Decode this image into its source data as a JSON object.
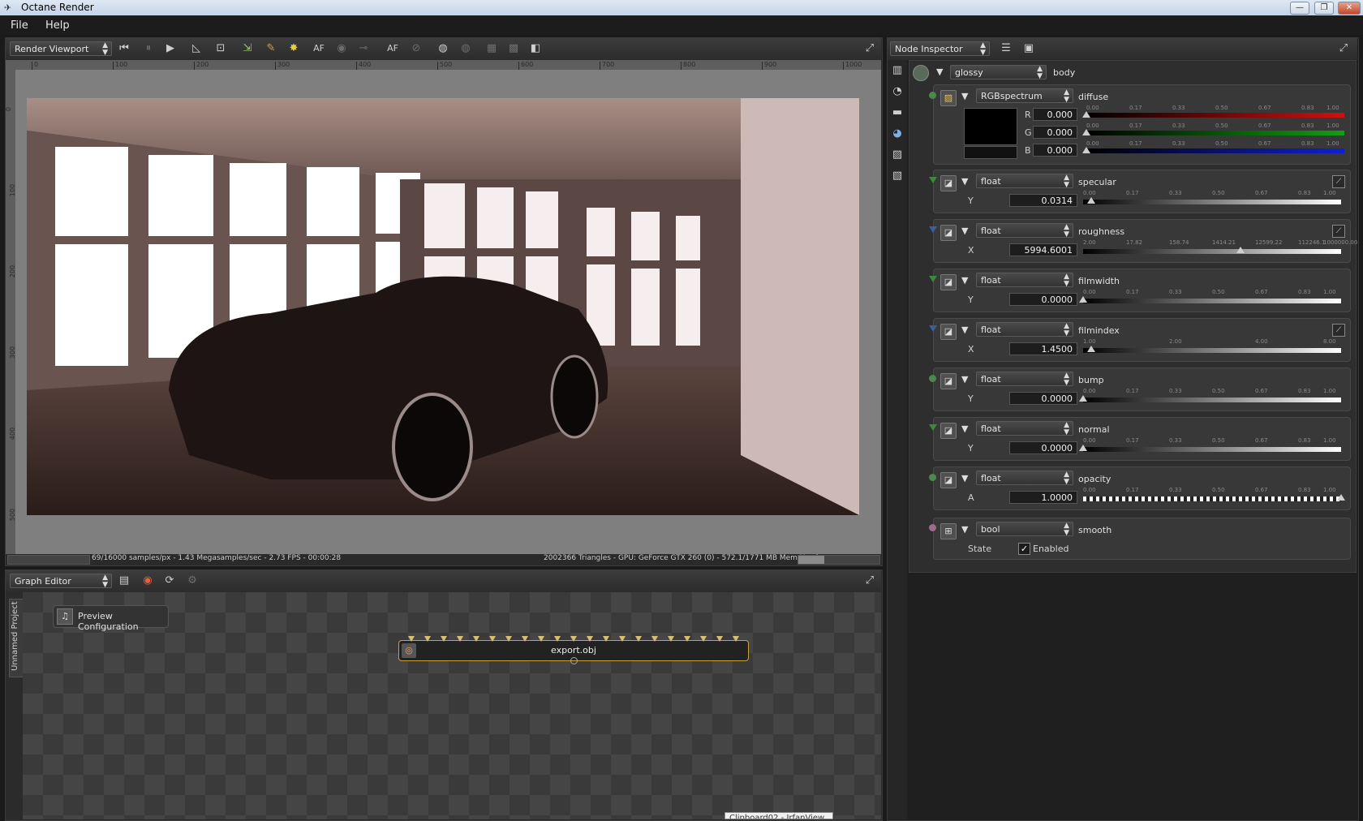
{
  "window": {
    "title": "Octane Render",
    "controls": [
      "minimize",
      "maximize",
      "close"
    ]
  },
  "menu": {
    "items": [
      "File",
      "Help"
    ]
  },
  "viewport": {
    "panel_select": "Render Viewport",
    "toolbar_icons": [
      "rewind-icon",
      "pause-icon",
      "play-icon",
      "measure-icon",
      "region-icon",
      "export-icon",
      "paint-icon",
      "light-icon",
      "af-icon",
      "gray-icon",
      "pick-icon",
      "af-label",
      "lock-icon",
      "world-icon",
      "world2-icon",
      "bg-icon",
      "checker-icon",
      "alpha-icon"
    ],
    "af_label": "AF",
    "ruler_h": [
      "0",
      "100",
      "200",
      "300",
      "400",
      "500",
      "600",
      "700",
      "800",
      "900",
      "1000"
    ],
    "ruler_v": [
      "0",
      "100",
      "200",
      "300",
      "400",
      "500"
    ],
    "status_left": "69/16000 samples/px - 1.43 Megasamples/sec - 2.73 FPS - 00:00:28",
    "status_right": "2002366 Triangles - GPU: GeForce GTX 260 (0) - 572.1/1771 MB Mem Used"
  },
  "graph_editor": {
    "panel_select": "Graph Editor",
    "side_tab": "Unnamed Project",
    "preview_button": "Preview Configuration",
    "node_label": "export.obj",
    "tooltip": "Clipboard02 - IrfanView"
  },
  "inspector": {
    "panel_select": "Node Inspector",
    "root": {
      "type": "glossy",
      "name": "body"
    },
    "diffuse": {
      "type": "RGBspectrum",
      "name": "diffuse",
      "channels": [
        {
          "label": "R",
          "value": "0.000",
          "color": "#d01010"
        },
        {
          "label": "G",
          "value": "0.000",
          "color": "#10a010"
        },
        {
          "label": "B",
          "value": "0.000",
          "color": "#1020d0"
        }
      ],
      "ticks": [
        "0.00",
        "0.17",
        "0.33",
        "0.50",
        "0.67",
        "0.83",
        "1.00"
      ]
    },
    "params": [
      {
        "type": "float",
        "name": "specular",
        "axis": "Y",
        "value": "0.0314",
        "pos": 0.0314,
        "ticks": [
          "0.00",
          "0.17",
          "0.33",
          "0.50",
          "0.67",
          "0.83",
          "1.00"
        ],
        "pin": "#3a8a3a"
      },
      {
        "type": "float",
        "name": "roughness",
        "axis": "X",
        "value": "5994.6001",
        "pos": 0.61,
        "ticks": [
          "2.00",
          "17.82",
          "158.74",
          "1414.21",
          "12599.22",
          "112246.1",
          "1000000.00"
        ],
        "pin": "#3a5fa0"
      },
      {
        "type": "float",
        "name": "filmwidth",
        "axis": "Y",
        "value": "0.0000",
        "pos": 0.0,
        "ticks": [
          "0.00",
          "0.17",
          "0.33",
          "0.50",
          "0.67",
          "0.83",
          "1.00"
        ],
        "pin": "#3a8a3a"
      },
      {
        "type": "float",
        "name": "filmindex",
        "axis": "X",
        "value": "1.4500",
        "pos": 0.032,
        "ticks": [
          "1.00",
          "2.00",
          "4.00",
          "8.00"
        ],
        "pin": "#3a5fa0"
      },
      {
        "type": "float",
        "name": "bump",
        "axis": "Y",
        "value": "0.0000",
        "pos": 0.0,
        "ticks": [
          "0.00",
          "0.17",
          "0.33",
          "0.50",
          "0.67",
          "0.83",
          "1.00"
        ],
        "pin": "#4a8a4a"
      },
      {
        "type": "float",
        "name": "normal",
        "axis": "Y",
        "value": "0.0000",
        "pos": 0.0,
        "ticks": [
          "0.00",
          "0.17",
          "0.33",
          "0.50",
          "0.67",
          "0.83",
          "1.00"
        ],
        "pin": "#3a8a3a"
      },
      {
        "type": "float",
        "name": "opacity",
        "axis": "A",
        "value": "1.0000",
        "pos": 1.0,
        "ticks": [
          "0.00",
          "0.17",
          "0.33",
          "0.50",
          "0.67",
          "0.83",
          "1.00"
        ],
        "pin": "#4a8a4a"
      }
    ],
    "smooth": {
      "type": "bool",
      "name": "smooth",
      "state_label": "State",
      "enabled_label": "Enabled",
      "checked": true,
      "pin": "#a06a8a"
    }
  }
}
